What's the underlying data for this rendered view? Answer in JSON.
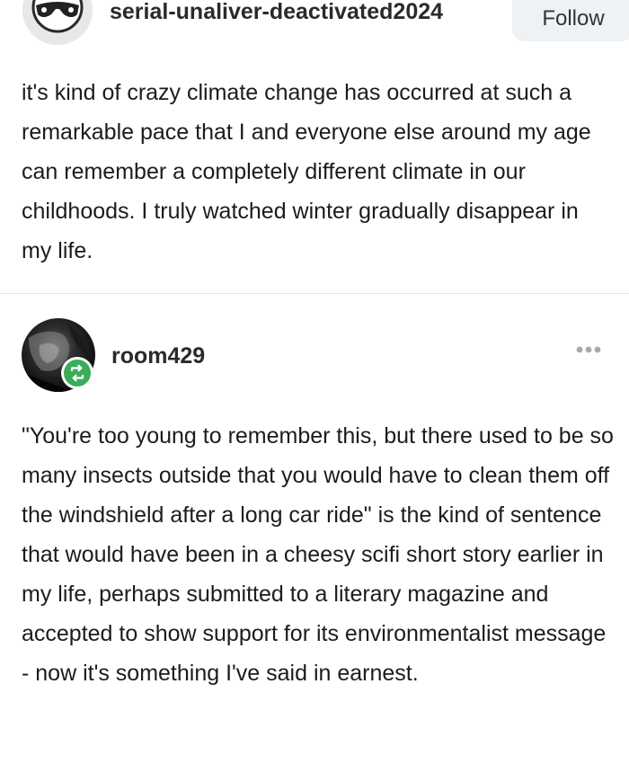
{
  "top_post": {
    "username": "serial-unaliver-deactivated2024",
    "follow_label": "Follow",
    "avatar_icon": "sunglasses-face-icon",
    "text": "it's kind of crazy climate change has occurred at such a remarkable pace that I and everyone else around my age can remember a completely different climate in our childhoods. I truly watched winter gradually disappear in my life."
  },
  "second_post": {
    "username": "room429",
    "avatar_icon": "dark-photo-avatar",
    "badge_icon": "reblog-icon",
    "menu_icon": "more-options-icon",
    "badge_color": "#3aac5a",
    "text": "\"You're too young to remember this, but there used to be so many insects outside that you would have to clean them off the windshield after a long car ride\" is the kind of sentence that would have been in a cheesy scifi short story earlier in my life, perhaps submitted to a literary magazine and accepted to show support for its environmentalist message - now it's something I've said in earnest."
  }
}
